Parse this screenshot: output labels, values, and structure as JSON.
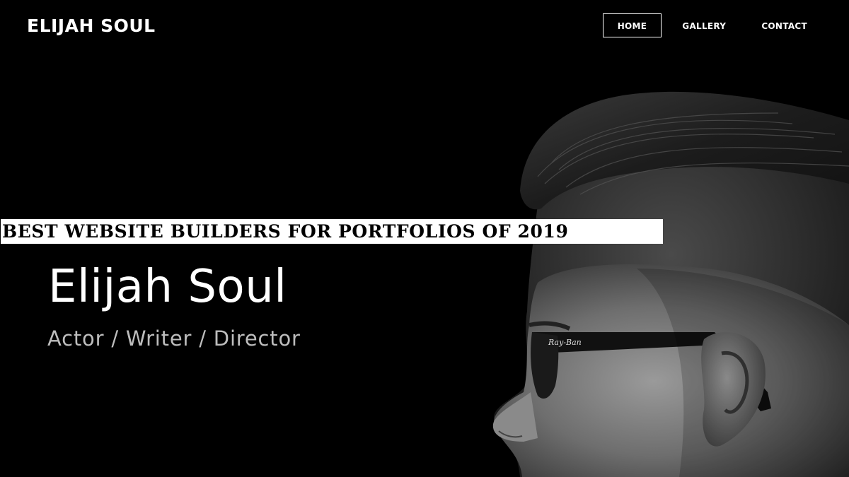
{
  "site": {
    "logo": "ELIJAH SOUL"
  },
  "nav": {
    "items": [
      {
        "label": "HOME",
        "active": true
      },
      {
        "label": "GALLERY",
        "active": false
      },
      {
        "label": "CONTACT",
        "active": false
      }
    ]
  },
  "banner": {
    "text": "BEST WEBSITE BUILDERS FOR PORTFOLIOS OF 2019"
  },
  "hero": {
    "title": "Elijah Soul",
    "subtitle": "Actor / Writer / Director",
    "glasses_brand": "Ray-Ban"
  },
  "colors": {
    "background": "#000000",
    "text": "#ffffff",
    "subtitle": "#bdbdbd",
    "banner_bg": "#ffffff",
    "banner_text": "#000000"
  }
}
